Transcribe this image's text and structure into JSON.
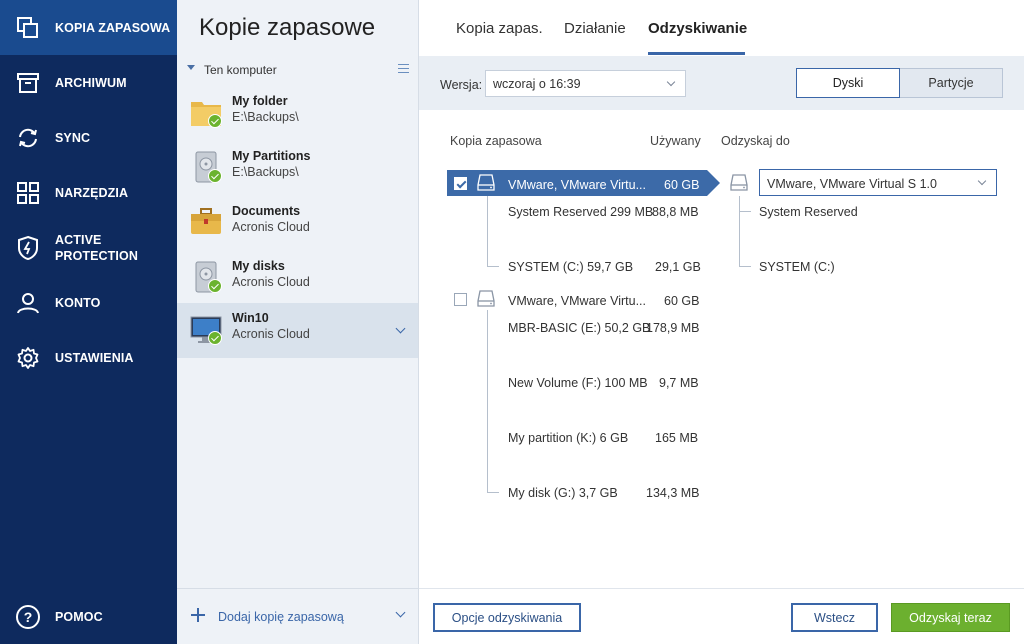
{
  "nav": {
    "items": [
      {
        "label": "KOPIA ZAPASOWA",
        "icon": "copy-icon"
      },
      {
        "label": "ARCHIWUM",
        "icon": "archive-icon"
      },
      {
        "label": "SYNC",
        "icon": "sync-icon"
      },
      {
        "label": "NARZĘDZIA",
        "icon": "tools-grid-icon"
      },
      {
        "label": "ACTIVE",
        "label2": "PROTECTION",
        "icon": "shield-icon"
      },
      {
        "label": "KONTO",
        "icon": "user-icon"
      },
      {
        "label": "USTAWIENIA",
        "icon": "gear-icon"
      }
    ],
    "help": {
      "label": "POMOC",
      "icon": "help-icon"
    }
  },
  "list": {
    "title": "Kopie zapasowe",
    "group": "Ten komputer",
    "items": [
      {
        "name": "My folder",
        "location": "E:\\Backups\\",
        "icon": "folder-icon"
      },
      {
        "name": "My Partitions",
        "location": "E:\\Backups\\",
        "icon": "hard-drive-icon"
      },
      {
        "name": "Documents",
        "location": "Acronis Cloud",
        "icon": "briefcase-icon"
      },
      {
        "name": "My disks",
        "location": "Acronis Cloud",
        "icon": "hard-drive-icon"
      },
      {
        "name": "Win10",
        "location": "Acronis Cloud",
        "icon": "monitor-icon"
      }
    ],
    "add_label": "Dodaj kopię zapasową"
  },
  "tabs": [
    "Kopia zapas.",
    "Działanie",
    "Odzyskiwanie"
  ],
  "toolbar": {
    "version_label": "Wersja:",
    "version_value": "wczoraj o 16:39",
    "seg_disks": "Dyski",
    "seg_partitions": "Partycje"
  },
  "table": {
    "col_backup": "Kopia zapasowa",
    "col_used": "Używany",
    "col_restore": "Odzyskaj do",
    "disks": [
      {
        "name": "VMware, VMware Virtu...",
        "used": "60 GB",
        "checked": true,
        "partitions": [
          {
            "name": "System Reserved 299 MB",
            "used": "88,8 MB"
          },
          {
            "name": "SYSTEM (C:) 59,7 GB",
            "used": "29,1 GB"
          }
        ]
      },
      {
        "name": "VMware, VMware Virtu...",
        "used": "60 GB",
        "checked": false,
        "partitions": [
          {
            "name": "MBR-BASIC (E:) 50,2 GB",
            "used": "178,9 MB"
          },
          {
            "name": "New Volume (F:) 100 MB",
            "used": "9,7 MB"
          },
          {
            "name": "My partition (K:) 6 GB",
            "used": "165 MB"
          },
          {
            "name": "My disk (G:) 3,7 GB",
            "used": "134,3 MB"
          }
        ]
      }
    ],
    "target": {
      "select_value": "VMware, VMware Virtual S 1.0",
      "partitions": [
        "System Reserved",
        "SYSTEM (C:)"
      ]
    }
  },
  "buttons": {
    "options": "Opcje odzyskiwania",
    "back": "Wstecz",
    "restore_now": "Odzyskaj teraz"
  },
  "colors": {
    "nav_bg": "#0e2a5e",
    "nav_active": "#1a4b8f",
    "accent": "#3a66a8",
    "primary_button": "#6cb02f"
  }
}
